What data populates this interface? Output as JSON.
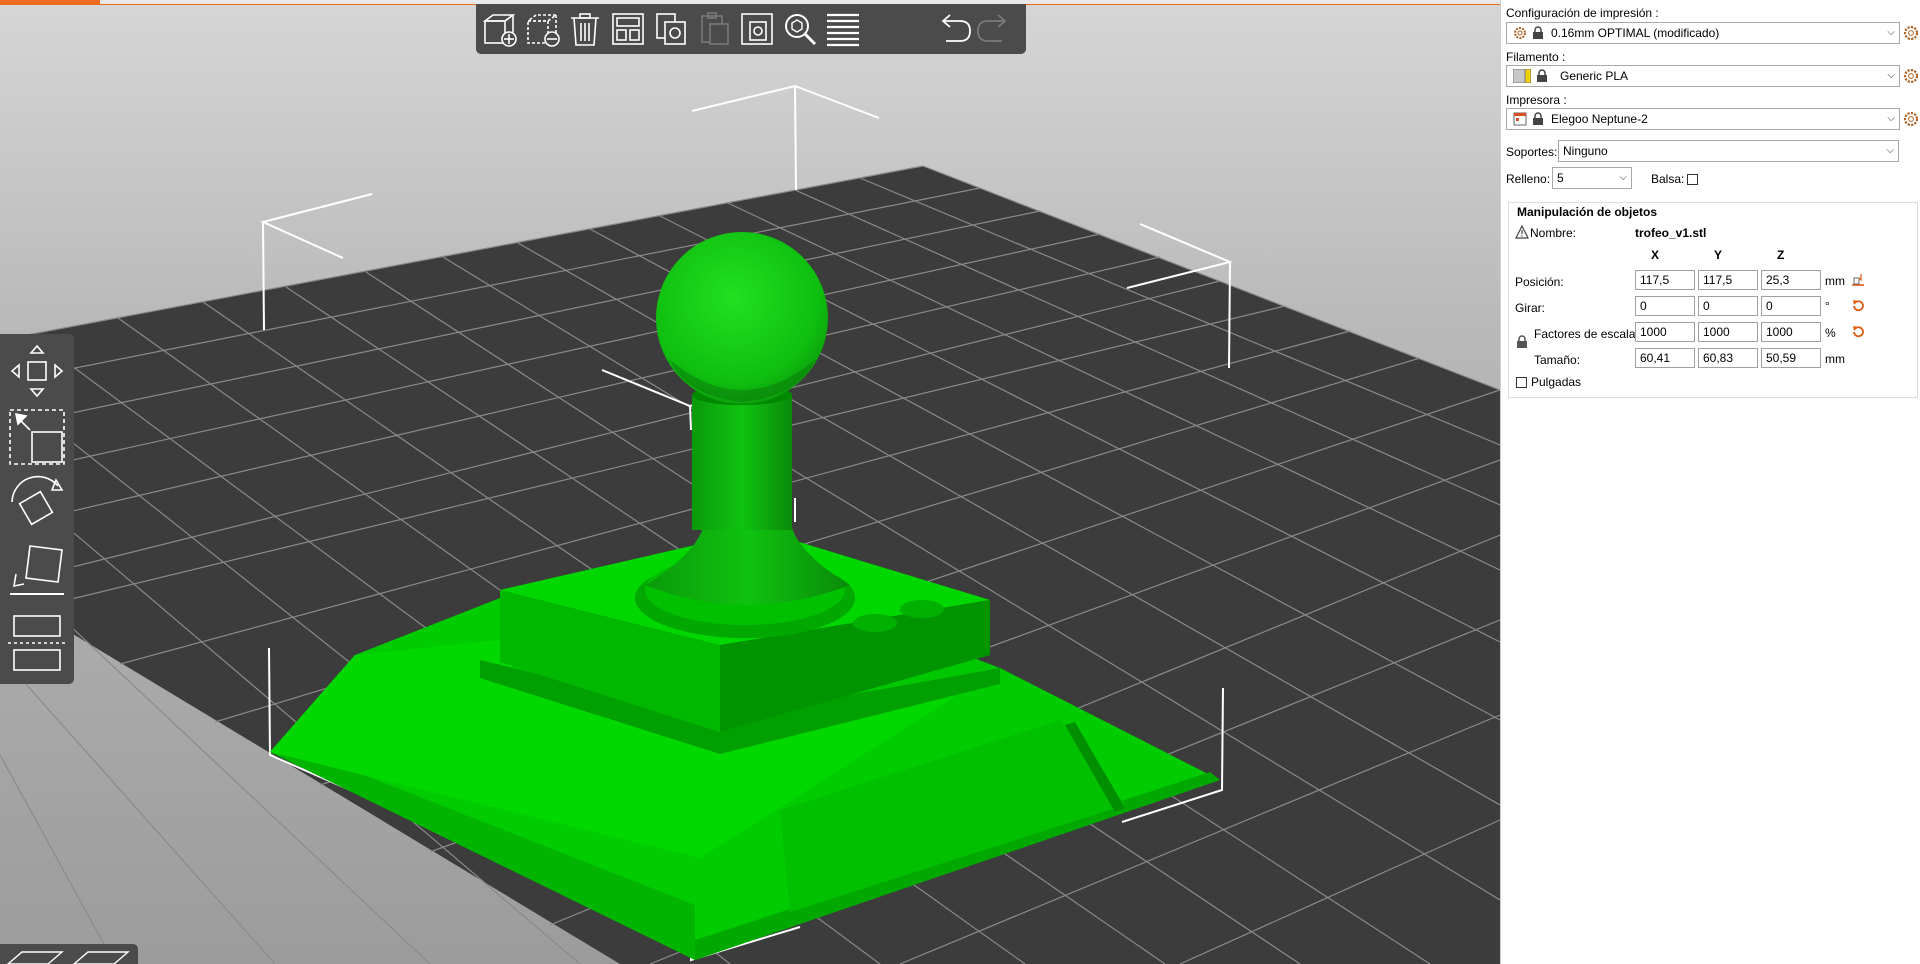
{
  "print_settings": {
    "label": "Configuración de impresión :",
    "value": "0.16mm OPTIMAL (modificado)"
  },
  "filament": {
    "label": "Filamento :",
    "value": "Generic PLA"
  },
  "printer": {
    "label": "Impresora :",
    "value": "Elegoo Neptune-2"
  },
  "supports": {
    "label": "Soportes:",
    "value": "Ninguno"
  },
  "infill": {
    "label": "Relleno:",
    "value": "5"
  },
  "raft": {
    "label": "Balsa:",
    "checked": false
  },
  "object_manipulation": {
    "title": "Manipulación de objetos",
    "name_label": "Nombre:",
    "name_value": "trofeo_v1.stl",
    "axes": [
      "X",
      "Y",
      "Z"
    ],
    "position": {
      "label": "Posición:",
      "values": [
        "117,5",
        "117,5",
        "25,3"
      ],
      "unit": "mm"
    },
    "rotate": {
      "label": "Girar:",
      "values": [
        "0",
        "0",
        "0"
      ],
      "unit": "°"
    },
    "scale": {
      "label": "Factores de escala:",
      "values": [
        "1000",
        "1000",
        "1000"
      ],
      "unit": "%"
    },
    "size": {
      "label": "Tamaño:",
      "values": [
        "60,41",
        "60,83",
        "50,59"
      ],
      "unit": "mm"
    },
    "inches": {
      "label": "Pulgadas",
      "checked": false
    }
  },
  "colors": {
    "accent": "#ed6b21",
    "model": "#00c800",
    "bed": "#3a3a3a",
    "toolbar": "#4b4b4b"
  },
  "toolbar_icons": [
    "add-icon",
    "delete-icon",
    "delete-all-icon",
    "arrange-icon",
    "copy-icon",
    "paste-icon",
    "instances-icon",
    "search-icon",
    "layers-icon",
    "undo-icon",
    "redo-icon"
  ],
  "gizmo_icons": [
    "move-icon",
    "scale-icon",
    "rotate-icon",
    "place-on-face-icon",
    "cut-icon"
  ]
}
